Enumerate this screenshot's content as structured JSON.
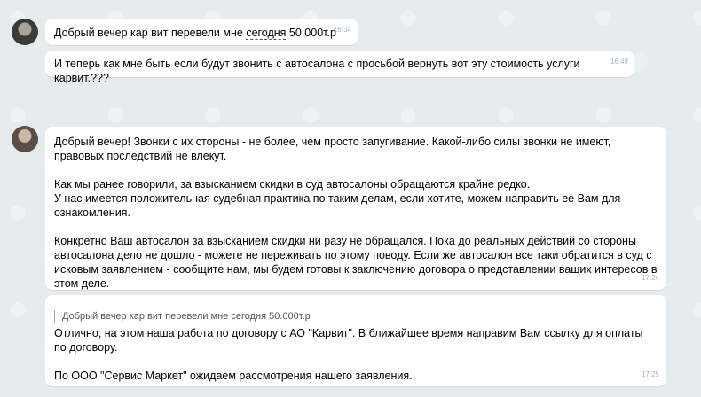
{
  "messages": [
    {
      "text_before": "Добрый вечер кар вит перевели мне ",
      "text_underlined": "сегодня",
      "text_after": " 50.000т.р",
      "time": "16:34"
    },
    {
      "text": "И теперь как мне быть если будут звонить с автосалона с просьбой вернуть вот эту стоимость услуги карвит.???",
      "time": "16:49"
    },
    {
      "paragraphs": [
        "Добрый вечер! Звонки с их стороны - не более, чем просто запугивание. Какой-либо силы звонки не имеют, правовых последствий не влекут.",
        "Как мы ранее говорили, за взысканием скидки в суд автосалоны обращаются крайне редко.",
        "У нас имеется положительная судебная практика по таким делам, если хотите, можем направить ее Вам для ознакомления.",
        "Конкретно Ваш автосалон за взысканием скидки ни разу не обращался. Пока до реальных действий со стороны автосалона дело не дошло - можете не переживать по этому поводу. Если же автосалон все таки обратится в суд с исковым заявлением - сообщите нам, мы будем готовы к заключению договора о представлении ваших интересов в этом деле."
      ],
      "time": "17:24"
    },
    {
      "quote": "Добрый вечер кар вит перевели мне сегодня 50.000т.р",
      "paragraphs": [
        "Отлично, на этом наша работа по договору с АО \"Карвит\". В ближайшее время направим Вам ссылку для оплаты по договору.",
        "По ООО \"Сервис Маркет\" ожидаем рассмотрения нашего заявления."
      ],
      "time": "17:25"
    }
  ]
}
